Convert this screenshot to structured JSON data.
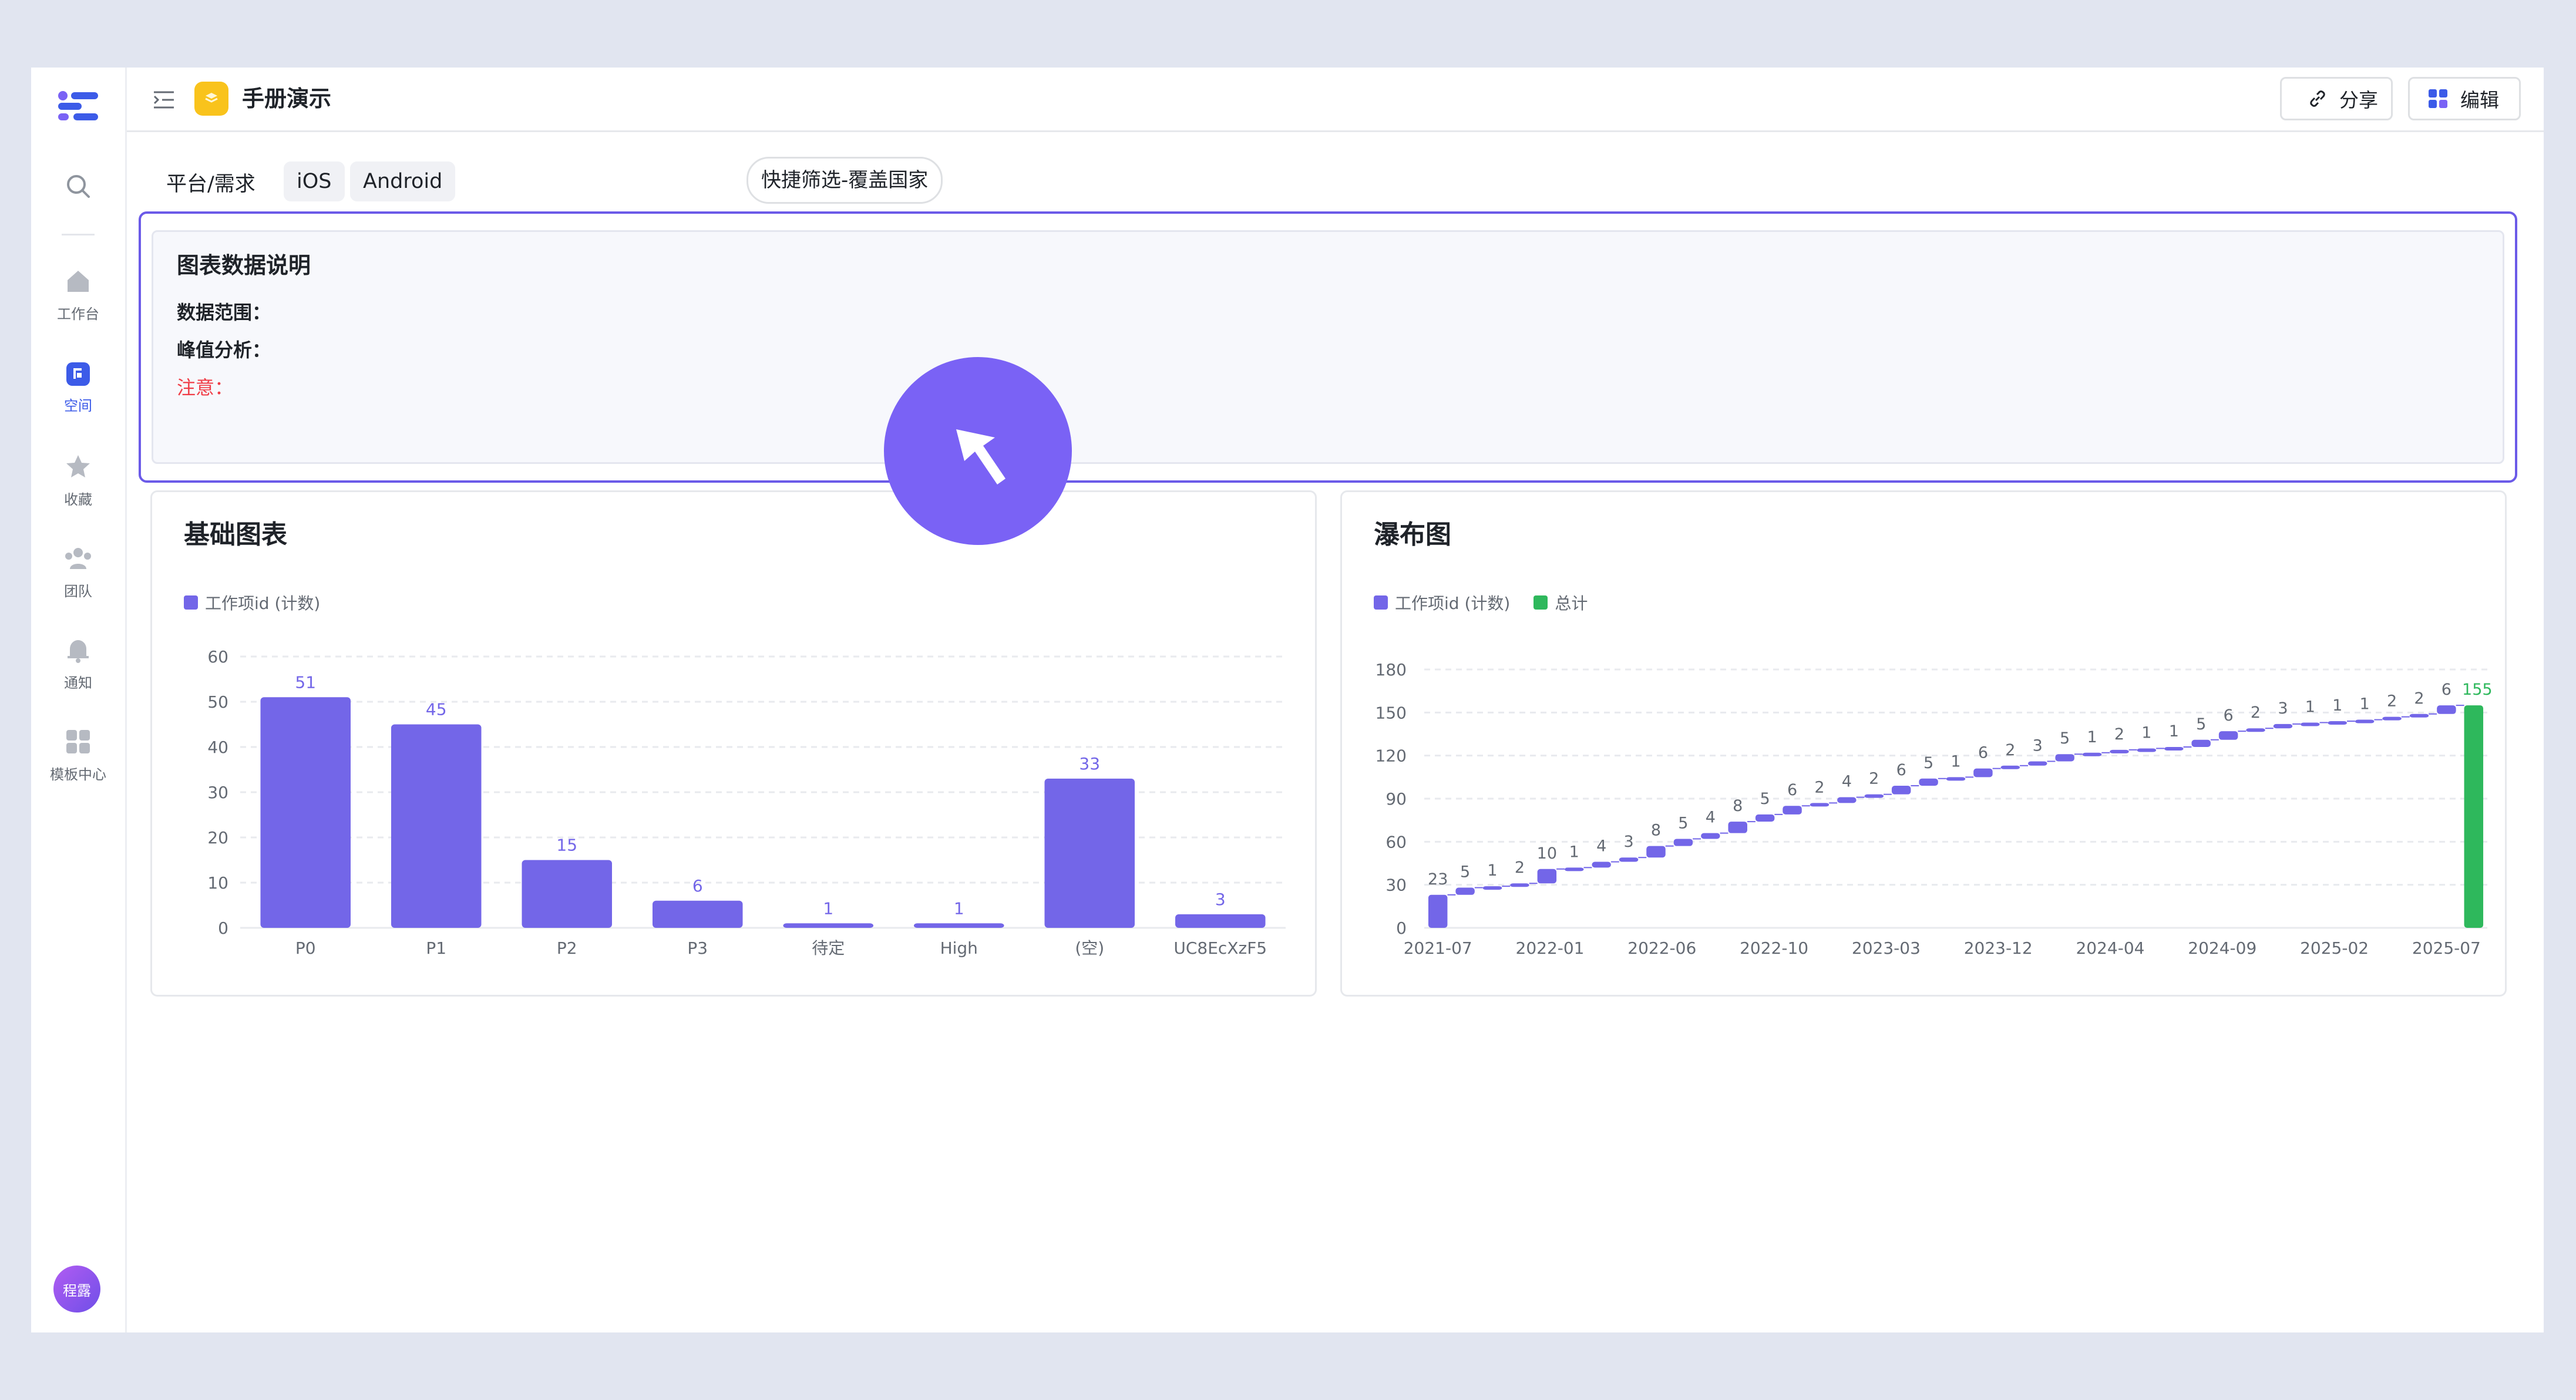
{
  "sidebar": {
    "items": [
      {
        "label": "工作台",
        "icon": "home-icon"
      },
      {
        "label": "空间",
        "icon": "space-icon"
      },
      {
        "label": "收藏",
        "icon": "star-icon"
      },
      {
        "label": "团队",
        "icon": "team-icon"
      },
      {
        "label": "通知",
        "icon": "bell-icon"
      },
      {
        "label": "模板中心",
        "icon": "template-icon"
      }
    ],
    "avatar_text": "程露"
  },
  "header": {
    "title": "手册演示",
    "share_label": "分享",
    "edit_label": "编辑"
  },
  "filters": {
    "label": "平台/需求",
    "chips": [
      "iOS",
      "Android"
    ],
    "quick_filter": "快捷筛选-覆盖国家"
  },
  "info_card": {
    "title": "图表数据说明",
    "line1": "数据范围：",
    "line2": "峰值分析：",
    "line3": "注意："
  },
  "colors": {
    "accent": "#7366e8",
    "total": "#2eb85c",
    "warning": "#f03d47"
  },
  "chart_data": [
    {
      "type": "bar",
      "title": "基础图表",
      "categories": [
        "P0",
        "P1",
        "P2",
        "P3",
        "待定",
        "High",
        "(空)",
        "UC8EcXzF5"
      ],
      "series": [
        {
          "name": "工作项id (计数)",
          "values": [
            51,
            45,
            15,
            6,
            1,
            1,
            33,
            3
          ]
        }
      ],
      "ylim": [
        0,
        60
      ],
      "yticks": [
        0,
        10,
        20,
        30,
        40,
        50,
        60
      ],
      "grid": true,
      "legend": "top-left"
    },
    {
      "type": "bar",
      "subtype": "waterfall",
      "title": "瀑布图",
      "series": [
        {
          "name": "工作项id (计数)",
          "values": [
            23,
            5,
            1,
            2,
            10,
            1,
            4,
            3,
            8,
            5,
            4,
            8,
            5,
            6,
            2,
            4,
            2,
            6,
            5,
            1,
            6,
            2,
            3,
            5,
            1,
            2,
            1,
            1,
            5,
            6,
            2,
            3,
            1,
            1,
            1,
            2,
            2,
            6
          ]
        },
        {
          "name": "总计",
          "values": [
            155
          ]
        }
      ],
      "x_tick_labels": [
        "2021-07",
        "2022-01",
        "2022-06",
        "2022-10",
        "2023-03",
        "2023-12",
        "2024-04",
        "2024-09",
        "2025-02",
        "2025-07"
      ],
      "ylim": [
        0,
        180
      ],
      "yticks": [
        0,
        30,
        60,
        90,
        120,
        150,
        180
      ],
      "grid": true,
      "legend": "top-left"
    }
  ]
}
